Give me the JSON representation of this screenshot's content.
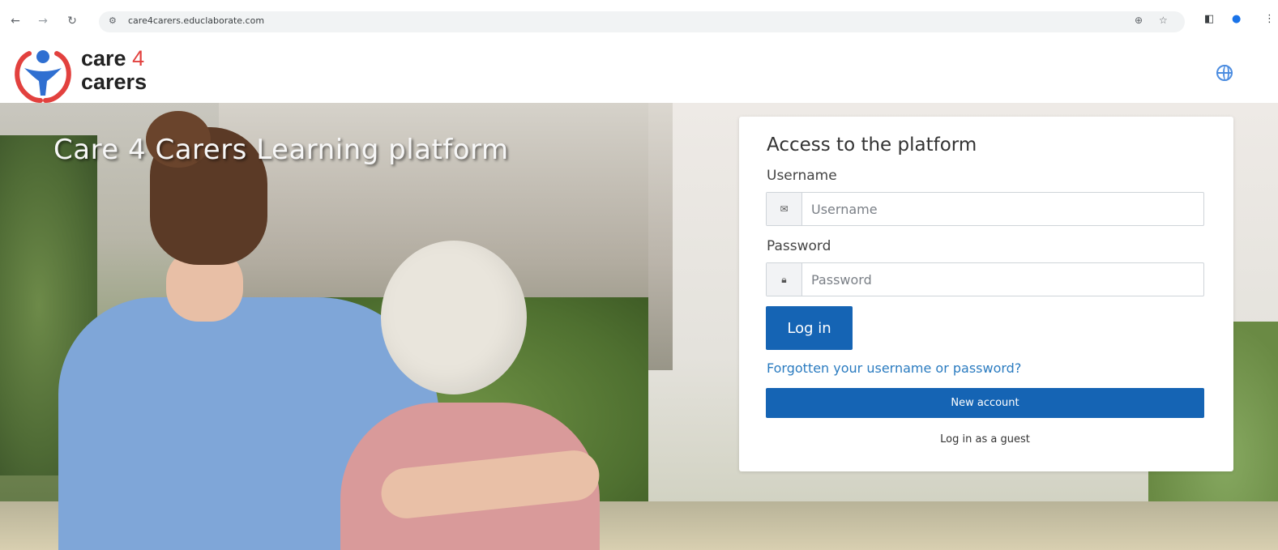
{
  "browser": {
    "url": "care4carers.educlaborate.com",
    "site_icon": "⚲",
    "icons": [
      "back-icon",
      "forward-icon",
      "reload-icon",
      "site-info-icon",
      "translate-icon",
      "star-icon",
      "sidepanel-icon",
      "profile-icon",
      "menu-icon"
    ]
  },
  "header": {
    "logo_line1": "care ",
    "logo_four": "4",
    "logo_line2": "carers",
    "language_icon": "globe-icon"
  },
  "hero": {
    "title": "Care 4 Carers Learning platform"
  },
  "login": {
    "heading": "Access to the platform",
    "username_label": "Username",
    "username_placeholder": "Username",
    "username_icon": "envelope-icon",
    "password_label": "Password",
    "password_placeholder": "Password",
    "password_icon": "lock-icon",
    "login_button": "Log in",
    "forgot_link": "Forgotten your username or password?",
    "new_account_button": "New account",
    "guest_link": "Log in as a guest"
  },
  "colors": {
    "primary": "#1564b4",
    "link": "#2a7bc0",
    "logo_red": "#e2413e",
    "logo_blue": "#2f6fd1"
  }
}
